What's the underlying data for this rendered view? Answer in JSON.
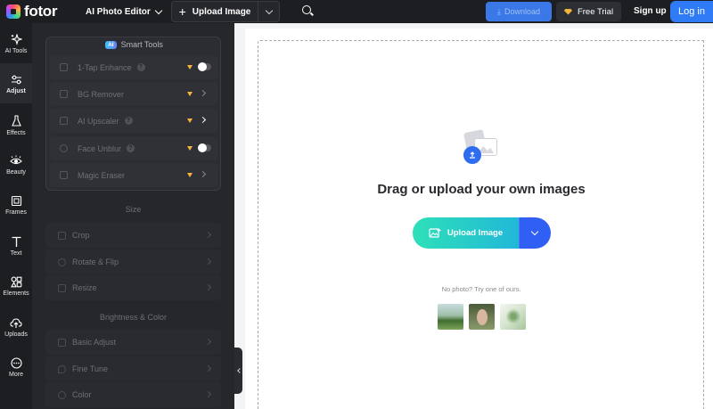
{
  "topbar": {
    "logo_text": "fotor",
    "editor_menu": "AI Photo Editor",
    "upload_label": "Upload Image",
    "download_label": "Download",
    "free_trial_label": "Free Trial",
    "signup_label": "Sign up",
    "login_label": "Log in"
  },
  "rail": {
    "items": [
      {
        "label": "AI Tools",
        "icon": "sparkle-icon"
      },
      {
        "label": "Adjust",
        "icon": "sliders-icon"
      },
      {
        "label": "Effects",
        "icon": "flask-icon"
      },
      {
        "label": "Beauty",
        "icon": "eye-icon"
      },
      {
        "label": "Frames",
        "icon": "frame-icon"
      },
      {
        "label": "Text",
        "icon": "text-icon"
      },
      {
        "label": "Elements",
        "icon": "elements-icon"
      },
      {
        "label": "Uploads",
        "icon": "cloud-upload-icon"
      },
      {
        "label": "More",
        "icon": "more-icon"
      }
    ],
    "active": "Adjust"
  },
  "panel": {
    "smart_tools_badge": "AI",
    "smart_tools_title": "Smart Tools",
    "tools": [
      {
        "label": "1-Tap Enhance",
        "control": "toggle"
      },
      {
        "label": "BG Remover",
        "control": "arrow"
      },
      {
        "label": "AI Upscaler",
        "control": "arrow"
      },
      {
        "label": "Face Unblur",
        "control": "toggle"
      },
      {
        "label": "Magic Eraser",
        "control": "arrow"
      }
    ],
    "size_heading": "Size",
    "size_options": [
      "Crop",
      "Rotate & Flip",
      "Resize"
    ],
    "brightness_heading": "Brightness & Color",
    "brightness_options": [
      "Basic Adjust",
      "Fine Tune",
      "Color"
    ]
  },
  "canvas": {
    "headline": "Drag or upload your own images",
    "upload_button": "Upload Image",
    "no_photo_text": "No photo? Try one of ours.",
    "samples": [
      "landscape-sample",
      "portrait-sample",
      "plant-sample"
    ]
  },
  "colors": {
    "topbar_bg": "#1d1e22",
    "panel_bg": "#26272b",
    "accent_blue": "#2f7bf5",
    "upload_gradient_start": "#2ee0b8",
    "upload_gradient_end": "#21b8d8",
    "premium_gold": "#f5b53d"
  }
}
